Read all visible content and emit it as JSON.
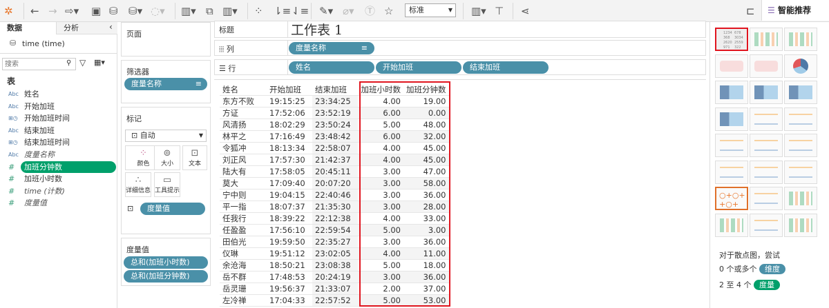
{
  "toolbar": {
    "icons": [
      "tableau-logo-icon",
      "undo-icon",
      "redo-icon",
      "replay-icon",
      "save-icon",
      "new-datasource-icon",
      "pause-update-icon",
      "refresh-icon",
      "new-worksheet-icon",
      "duplicate-sheet-icon",
      "clear-sheet-icon",
      "swap-icon",
      "sort-asc-icon",
      "sort-desc-icon",
      "highlight-icon",
      "attach-icon",
      "label-icon",
      "pin-icon",
      "show-cards-icon",
      "presentation-icon",
      "share-icon",
      "tooltip-icon"
    ],
    "fit_select": "标准",
    "smart_label": "智能推荐"
  },
  "left": {
    "tab_data": "数据",
    "tab_analysis": "分析",
    "datasource": "time (time)",
    "search_placeholder": "搜索",
    "table_label": "表",
    "fields": [
      {
        "type": "Abc",
        "name": "姓名"
      },
      {
        "type": "Abc",
        "name": "开始加班"
      },
      {
        "type": "dt",
        "name": "开始加班时间"
      },
      {
        "type": "Abc",
        "name": "结束加班"
      },
      {
        "type": "dt",
        "name": "结束加班时间"
      },
      {
        "type": "Abc",
        "name": "度量名称"
      },
      {
        "type": "#",
        "name": "加班分钟数"
      },
      {
        "type": "#",
        "name": "加班小时数"
      },
      {
        "type": "#",
        "name": "time (计数)"
      },
      {
        "type": "#",
        "name": "度量值"
      }
    ]
  },
  "cards": {
    "pages": "页面",
    "filters": "筛选器",
    "filter_pill": "度量名称",
    "marks": "标记",
    "mark_type": "自动",
    "color": "颜色",
    "size": "大小",
    "text": "文本",
    "detail": "详细信息",
    "tooltip": "工具提示",
    "marks_pill": "度量值",
    "measure_values": "度量值",
    "mv1": "总和(加班小时数)",
    "mv2": "总和(加班分钟数)"
  },
  "shelves": {
    "title_label": "标题",
    "title": "工作表 1",
    "columns_label": "列",
    "columns_pill": "度量名称",
    "rows_label": "行",
    "rows_pills": [
      "姓名",
      "开始加班",
      "结束加班"
    ]
  },
  "table": {
    "headers": [
      "姓名",
      "开始加班",
      "结束加班",
      "加班小时数",
      "加班分钟数"
    ],
    "rows": [
      [
        "东方不败",
        "19:15:25",
        "23:34:25",
        "4.00",
        "19.00"
      ],
      [
        "方证",
        "17:52:06",
        "23:52:19",
        "6.00",
        "0.00"
      ],
      [
        "风清扬",
        "18:02:29",
        "23:50:24",
        "5.00",
        "48.00"
      ],
      [
        "林平之",
        "17:16:49",
        "23:48:42",
        "6.00",
        "32.00"
      ],
      [
        "令狐冲",
        "18:13:34",
        "22:58:07",
        "4.00",
        "45.00"
      ],
      [
        "刘正风",
        "17:57:30",
        "21:42:37",
        "4.00",
        "45.00"
      ],
      [
        "陆大有",
        "17:58:05",
        "20:45:11",
        "3.00",
        "47.00"
      ],
      [
        "莫大",
        "17:09:40",
        "20:07:20",
        "3.00",
        "58.00"
      ],
      [
        "宁中则",
        "19:04:15",
        "22:40:46",
        "3.00",
        "36.00"
      ],
      [
        "平一指",
        "18:07:37",
        "21:35:30",
        "3.00",
        "28.00"
      ],
      [
        "任我行",
        "18:39:22",
        "22:12:38",
        "4.00",
        "33.00"
      ],
      [
        "任盈盈",
        "17:56:10",
        "22:59:54",
        "5.00",
        "3.00"
      ],
      [
        "田伯光",
        "19:59:50",
        "22:35:27",
        "3.00",
        "36.00"
      ],
      [
        "仪琳",
        "19:51:12",
        "23:02:05",
        "4.00",
        "11.00"
      ],
      [
        "余沧海",
        "18:50:21",
        "23:08:38",
        "5.00",
        "18.00"
      ],
      [
        "岳不群",
        "17:48:53",
        "20:24:19",
        "3.00",
        "36.00"
      ],
      [
        "岳灵珊",
        "19:56:37",
        "21:33:07",
        "2.00",
        "37.00"
      ],
      [
        "左冷禅",
        "17:04:33",
        "22:57:52",
        "5.00",
        "53.00"
      ]
    ]
  },
  "show_me": {
    "thumbs": [
      "text-table",
      "heat-map",
      "highlight-table",
      "symbol-map",
      "filled-map",
      "pie-chart",
      "horizontal-bars",
      "stacked-bars",
      "side-by-side-bars",
      "treemap",
      "circle-view",
      "side-by-side-circles",
      "line-continuous",
      "line-discrete",
      "dual-lines",
      "area-continuous",
      "area-discrete",
      "dual-combination",
      "scatter-plot",
      "histogram",
      "box-whisker",
      "gantt",
      "bullet-graph",
      "packed-bubbles"
    ],
    "thumb_text": [
      "1234",
      "678",
      "368",
      "3034",
      "2620",
      "2559",
      "971",
      "322"
    ],
    "hint": "对于散点图，尝试",
    "dims_prefix": "0 个或多个",
    "dims": "维度",
    "meas_prefix": "2 至 4 个",
    "meas": "度量"
  },
  "colors": {
    "dimension": "#4a90a8",
    "measure": "#00a06b",
    "highlight": "#e0141e"
  }
}
